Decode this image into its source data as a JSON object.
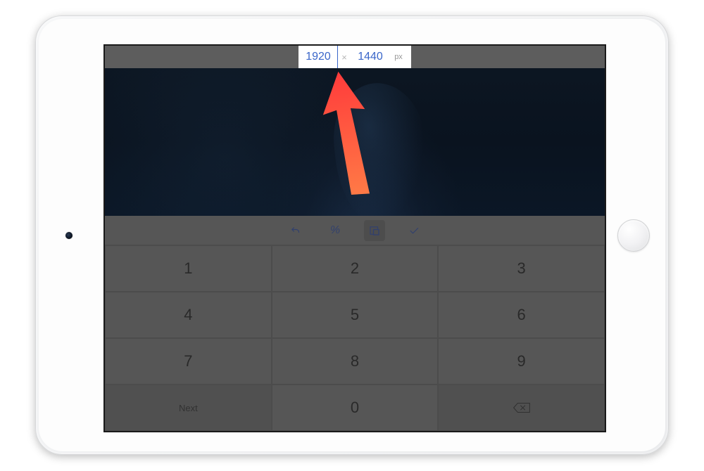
{
  "dimensions": {
    "width": "1920",
    "height": "1440",
    "separator": "×",
    "unit": "px"
  },
  "toolbar": {
    "undo": "undo",
    "percent": "%",
    "aspect": "aspect",
    "confirm": "confirm"
  },
  "keypad": {
    "rows": [
      [
        "1",
        "2",
        "3"
      ],
      [
        "4",
        "5",
        "6"
      ],
      [
        "7",
        "8",
        "9"
      ]
    ],
    "bottom": {
      "next": "Next",
      "zero": "0",
      "backspace": "⌫"
    }
  },
  "annotation": {
    "arrow_color_top": "#ff4a3d",
    "arrow_color_bottom": "#ff6a4a"
  }
}
